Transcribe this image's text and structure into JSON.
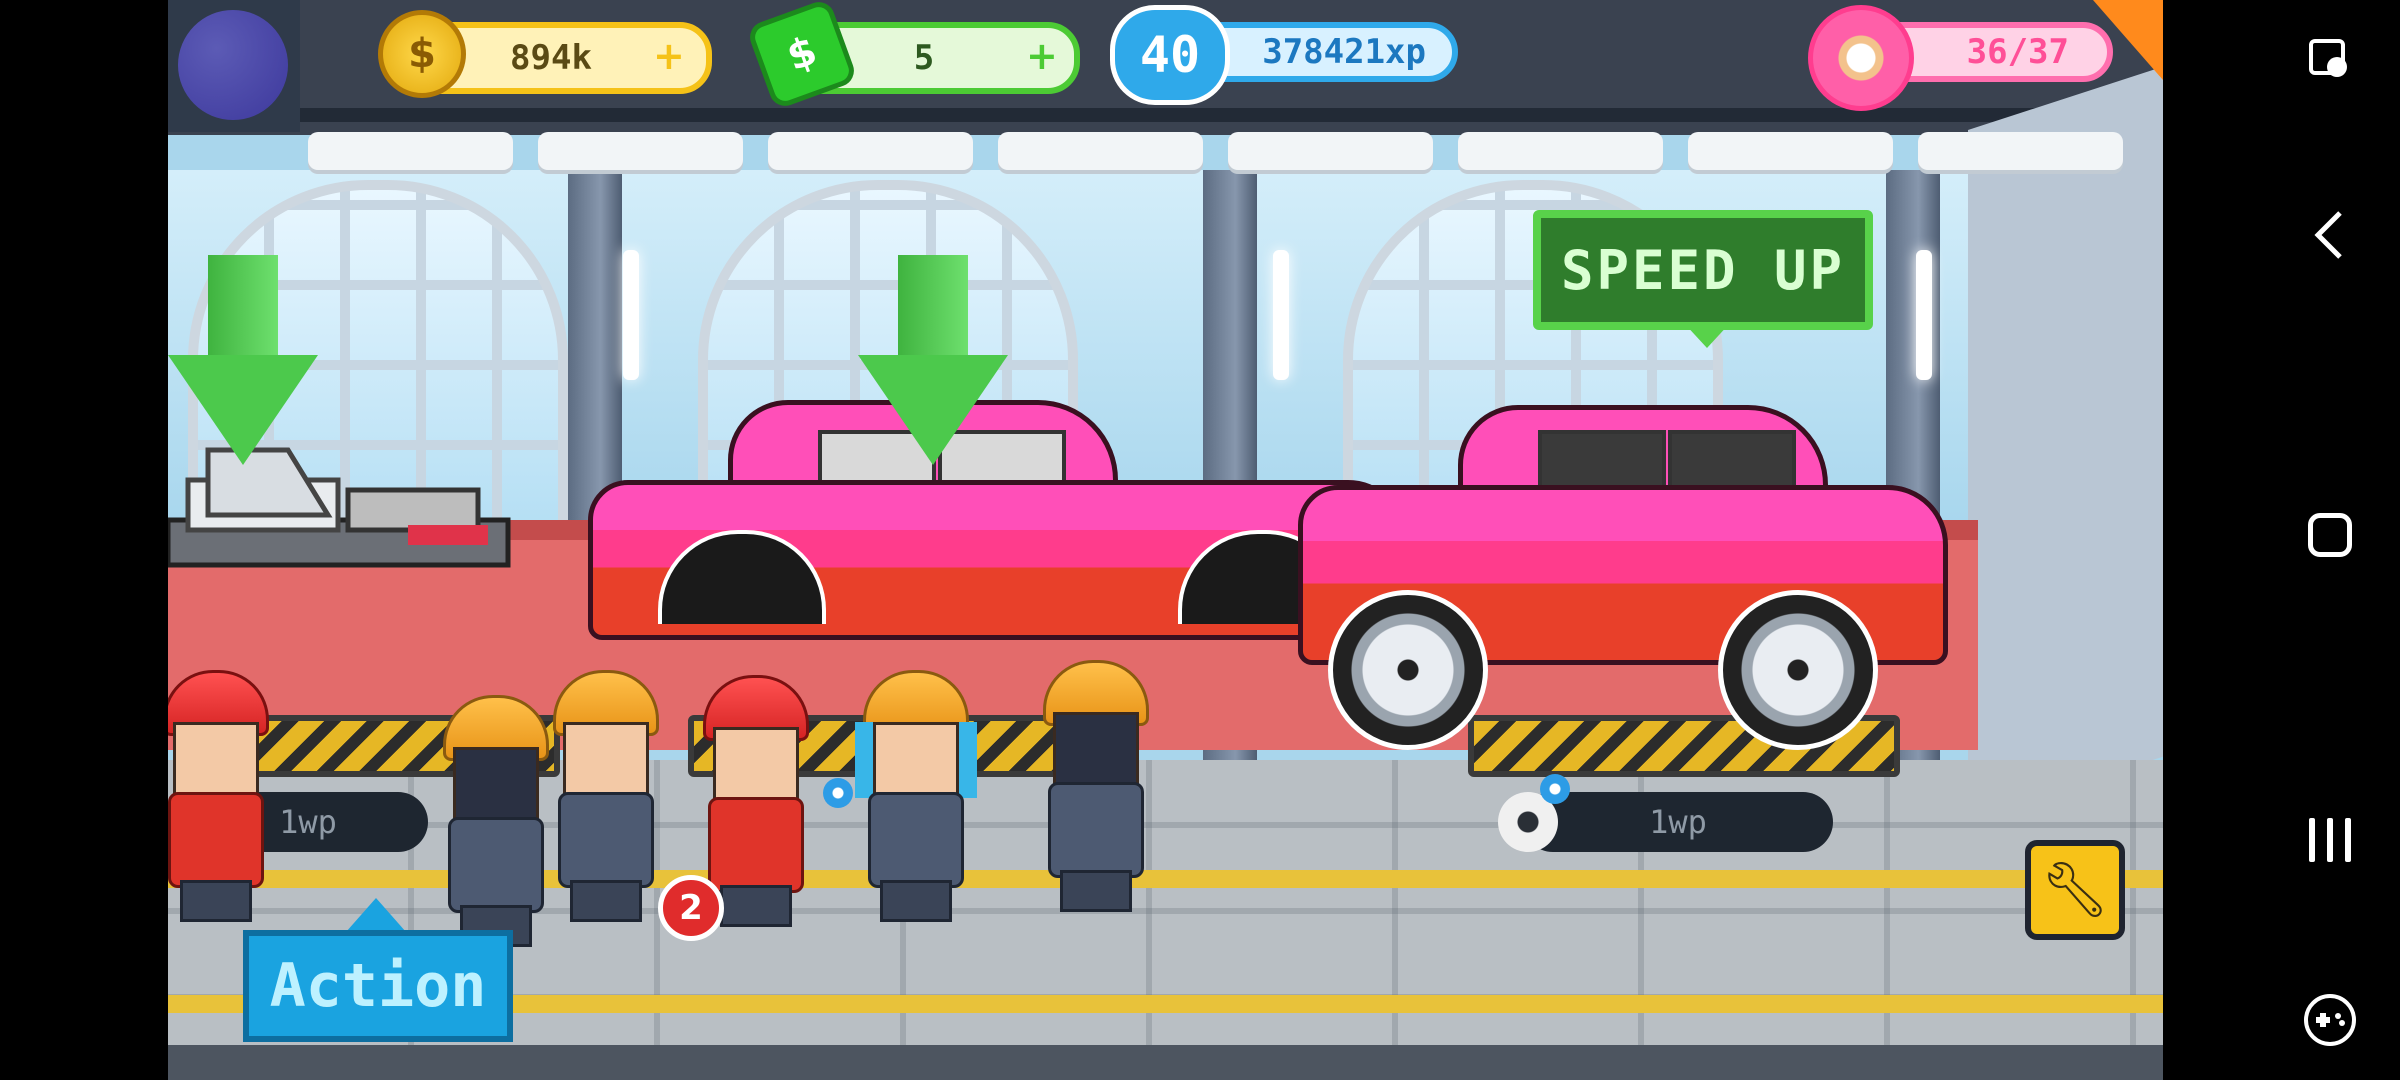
{
  "hud": {
    "coins": "894k",
    "cash": "5",
    "level": "40",
    "xp": "378421xp",
    "donuts": "36/37"
  },
  "speed_up_label": "SPEED UP",
  "stations": [
    {
      "label": "1wp"
    },
    {
      "label": "1wp"
    }
  ],
  "notification_count": "2",
  "action_label": "Action",
  "icons": {
    "coin": "coin-icon",
    "cash": "cash-icon",
    "level": "level-badge-icon",
    "donut": "donut-icon",
    "wrench": "wrench-icon",
    "gear": "gear-icon"
  },
  "colors": {
    "coins_border": "#f5c218",
    "cash_border": "#4ccb34",
    "xp_border": "#2fa9ea",
    "donut_border": "#ff6eae",
    "speed_up_bg": "#2f7d2c",
    "action_bg": "#1aa3e0",
    "car_body": "#ff4fb8"
  }
}
